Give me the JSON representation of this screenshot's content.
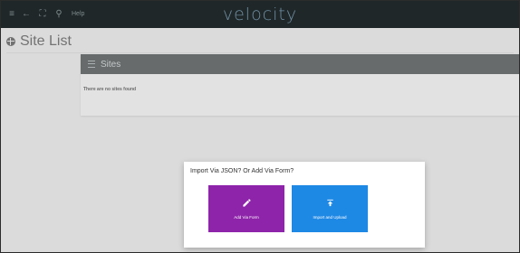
{
  "topbar": {
    "icons": [
      "menu-icon",
      "back-icon",
      "fullscreen-icon",
      "search-icon"
    ],
    "help_label": "Help",
    "brand": "velocity"
  },
  "page": {
    "title": "Site List",
    "title_icon": "globe-icon"
  },
  "sites_card": {
    "header_title": "Sites",
    "header_icon": "menu-icon",
    "empty_message": "There are no sites found"
  },
  "modal": {
    "title": "Import Via JSON? Or Add Via Form?",
    "options": [
      {
        "label": "Add Via Form",
        "icon": "pencil-icon",
        "color": "#8e24aa"
      },
      {
        "label": "Import and Upload",
        "icon": "upload-icon",
        "color": "#1e88e5"
      }
    ]
  },
  "colors": {
    "topbar": "#1f2729",
    "accent_purple": "#8e24aa",
    "accent_blue": "#1e88e5"
  }
}
